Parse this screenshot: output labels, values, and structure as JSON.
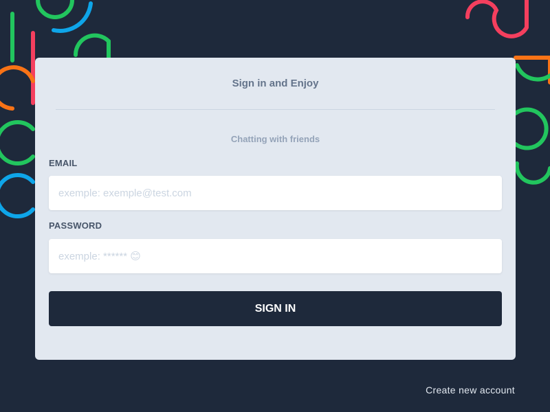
{
  "form": {
    "title": "Sign in and Enjoy",
    "subtitle": "Chatting with friends",
    "email": {
      "label": "EMAIL",
      "value": "",
      "placeholder": "exemple: exemple@test.com"
    },
    "password": {
      "label": "PASSWORD",
      "value": "",
      "placeholder": "exemple: ****** 😊"
    },
    "submit_label": "SIGN IN"
  },
  "footer": {
    "create_account_label": "Create new account"
  },
  "colors": {
    "background": "#1e293b",
    "card": "#e2e8f0",
    "button": "#1e293b",
    "accent_red": "#f43f5e",
    "accent_orange": "#f97316",
    "accent_green": "#22c55e",
    "accent_blue": "#0ea5e9"
  }
}
